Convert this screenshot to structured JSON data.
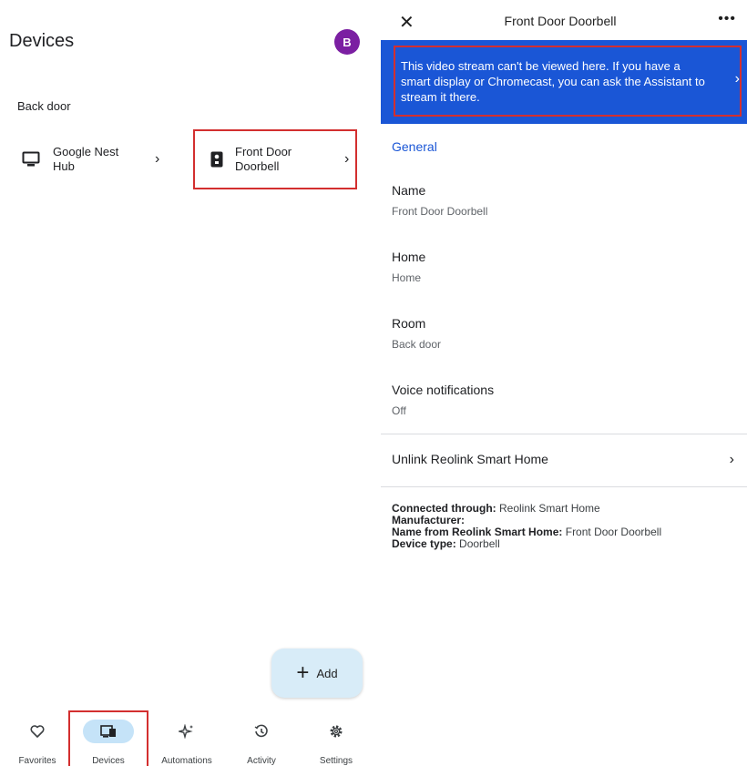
{
  "left": {
    "title": "Devices",
    "avatar_initial": "B",
    "room_label": "Back door",
    "devices": [
      {
        "name": "Google Nest Hub",
        "icon": "display-icon"
      },
      {
        "name": "Front Door Doorbell",
        "icon": "doorbell-icon"
      }
    ],
    "add_label": "Add",
    "nav": [
      {
        "label": "Favorites",
        "icon": "heart-icon"
      },
      {
        "label": "Devices",
        "icon": "devices-icon"
      },
      {
        "label": "Automations",
        "icon": "sparkle-icon"
      },
      {
        "label": "Activity",
        "icon": "history-icon"
      },
      {
        "label": "Settings",
        "icon": "gear-icon"
      }
    ]
  },
  "right": {
    "title": "Front Door Doorbell",
    "banner": "This video stream can't be viewed here. If you have a smart display or Chromecast, you can ask the Assistant to stream it there.",
    "section": "General",
    "fields": [
      {
        "label": "Name",
        "value": "Front Door Doorbell"
      },
      {
        "label": "Home",
        "value": "Home"
      },
      {
        "label": "Room",
        "value": "Back door"
      },
      {
        "label": "Voice notifications",
        "value": "Off"
      }
    ],
    "unlink": "Unlink Reolink Smart Home",
    "info": {
      "connected_label": "Connected through:",
      "connected_value": "Reolink Smart Home",
      "manufacturer_label": "Manufacturer:",
      "manufacturer_value": "",
      "name_from_label": "Name from Reolink Smart Home:",
      "name_from_value": "Front Door Doorbell",
      "device_type_label": "Device type:",
      "device_type_value": "Doorbell"
    }
  },
  "colors": {
    "accent": "#1a56d6",
    "avatar": "#7b1fa2",
    "highlight": "#d32f2f",
    "nav_active": "#c5e3f8"
  }
}
